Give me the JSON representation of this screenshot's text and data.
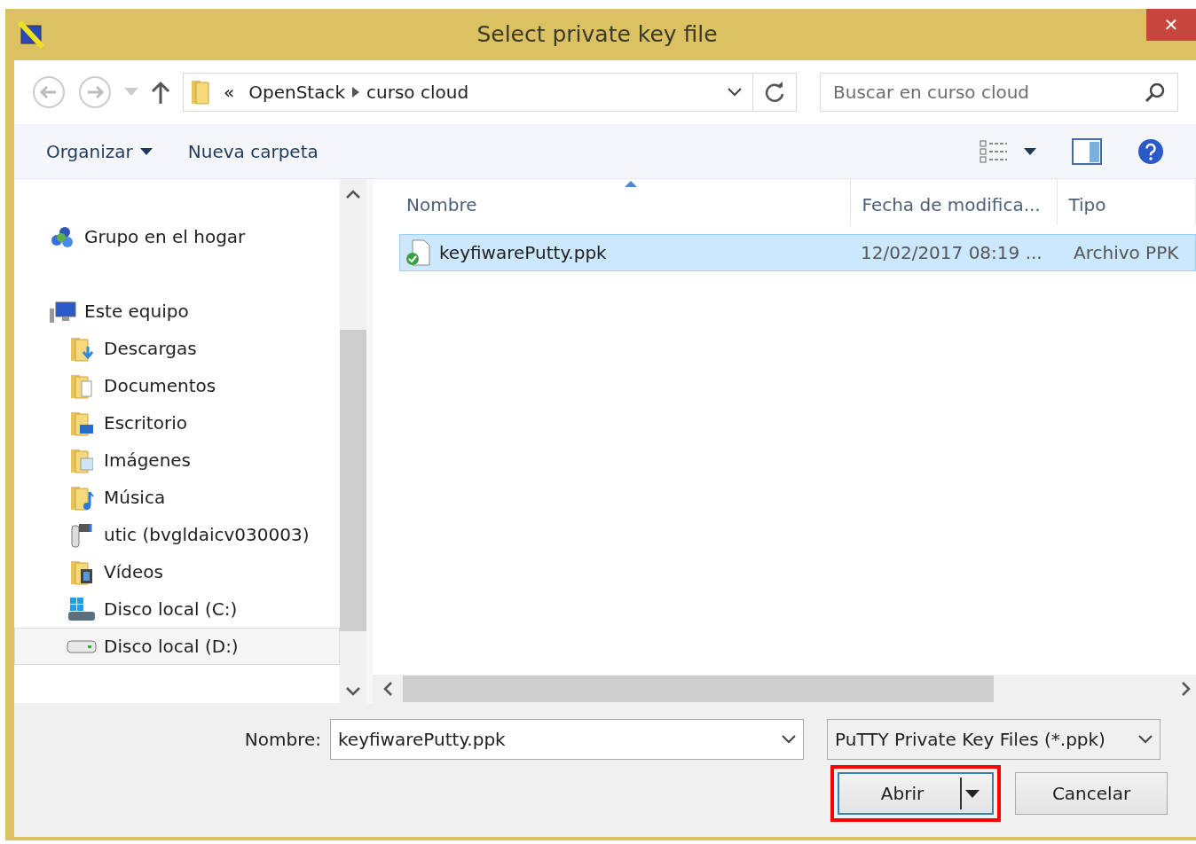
{
  "window": {
    "title": "Select private key file",
    "close": "✕"
  },
  "address": {
    "overflow": "«",
    "segments": [
      "OpenStack",
      "curso cloud"
    ]
  },
  "search": {
    "placeholder": "Buscar en curso cloud"
  },
  "toolbar": {
    "organize": "Organizar",
    "new_folder": "Nueva carpeta"
  },
  "navigation": [
    {
      "label": "Grupo en el hogar",
      "kind": "homegroup",
      "selected": false
    },
    {
      "label": "Este equipo",
      "kind": "computer",
      "selected": false,
      "children": [
        {
          "label": "Descargas",
          "kind": "downloads",
          "selected": false
        },
        {
          "label": "Documentos",
          "kind": "documents",
          "selected": false
        },
        {
          "label": "Escritorio",
          "kind": "desktop",
          "selected": false
        },
        {
          "label": "Imágenes",
          "kind": "pictures",
          "selected": false
        },
        {
          "label": "Música",
          "kind": "music",
          "selected": false
        },
        {
          "label": "utic (bvgldaicv030003)",
          "kind": "netdrive",
          "selected": false
        },
        {
          "label": "Vídeos",
          "kind": "videos",
          "selected": false
        },
        {
          "label": "Disco local (C:)",
          "kind": "sysdrive",
          "selected": false
        },
        {
          "label": "Disco local (D:)",
          "kind": "drive",
          "selected": true
        }
      ]
    }
  ],
  "files": {
    "columns": [
      {
        "label": "Nombre",
        "sorted": true
      },
      {
        "label": "Fecha de modifica...",
        "sorted": false
      },
      {
        "label": "Tipo",
        "sorted": false
      }
    ],
    "rows": [
      {
        "name": "keyfiwarePutty.ppk",
        "modified": "12/02/2017 08:19 ...",
        "type": "Archivo PPK",
        "selected": true
      }
    ]
  },
  "footer": {
    "name_label": "Nombre:",
    "name_value": "keyfiwarePutty.ppk",
    "filter": "PuTTY Private Key Files (*.ppk)",
    "buttons": [
      {
        "label": "Abrir",
        "kind": "split",
        "highlighted": true
      },
      {
        "label": "Cancelar",
        "kind": "plain",
        "highlighted": false
      }
    ]
  }
}
